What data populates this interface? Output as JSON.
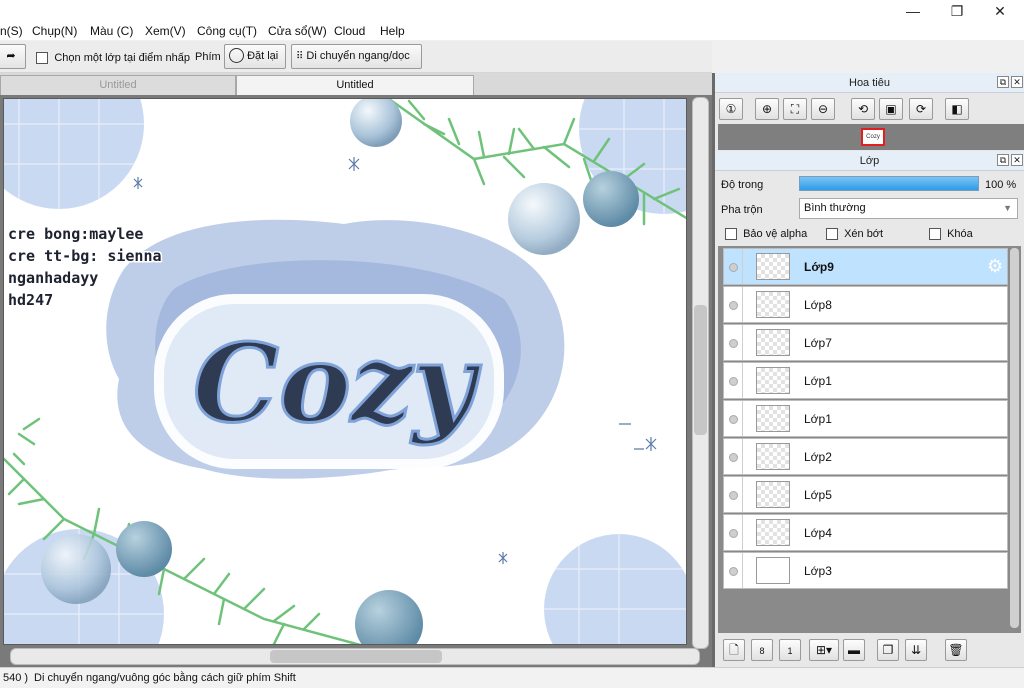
{
  "menu": [
    {
      "id": "menu-select",
      "label": "n(S)"
    },
    {
      "id": "menu-capture",
      "label": "Chụp(N)"
    },
    {
      "id": "menu-color",
      "label": "Màu (C)"
    },
    {
      "id": "menu-view",
      "label": "Xem(V)"
    },
    {
      "id": "menu-tools",
      "label": "Công cụ(T)"
    },
    {
      "id": "menu-window",
      "label": "Cửa sổ(W)"
    },
    {
      "id": "menu-cloud",
      "label": "Cloud"
    },
    {
      "id": "menu-help",
      "label": "Help"
    }
  ],
  "window_controls": {
    "minimize": "—",
    "maximize": "❐",
    "close": "✕"
  },
  "toolbar": {
    "select_layer_label": "Chọn một lớp tại điểm nhấp",
    "key_label": "Phím",
    "reset_label": "Đặt lại",
    "move_label": "Di chuyển ngang/dọc"
  },
  "tabs": [
    {
      "label": "Untitled",
      "active": false
    },
    {
      "label": "Untitled",
      "active": true
    }
  ],
  "canvas_art": {
    "credits": [
      "cre bong:maylee",
      "cre tt-bg: sienna",
      "nganhadayy",
      "hd247"
    ],
    "title_text": "Cozy"
  },
  "navigator": {
    "title": "Hoa tiêu",
    "thumb_text": "Cozy",
    "buttons": [
      "zoom-actual-icon",
      "zoom-in-icon",
      "fit-icon",
      "zoom-out-icon",
      "rotate-left-icon",
      "fit-screen-icon",
      "rotate-right-icon",
      "flip-icon"
    ]
  },
  "layers": {
    "title": "Lớp",
    "opacity_label": "Độ trong",
    "opacity_value": "100 %",
    "opacity": 1.0,
    "blend_label": "Pha trộn",
    "blend_value": "Bình thường",
    "protect_alpha_label": "Bảo vệ alpha",
    "clip_label": "Xén bớt",
    "lock_label": "Khóa",
    "items": [
      {
        "name": "Lớp9",
        "selected": true
      },
      {
        "name": "Lớp8",
        "selected": false
      },
      {
        "name": "Lớp7",
        "selected": false
      },
      {
        "name": "Lớp1",
        "selected": false
      },
      {
        "name": "Lớp1",
        "selected": false
      },
      {
        "name": "Lớp2",
        "selected": false
      },
      {
        "name": "Lớp5",
        "selected": false
      },
      {
        "name": "Lớp4",
        "selected": false
      },
      {
        "name": "Lớp3",
        "selected": false
      }
    ]
  },
  "status": {
    "coords": "540 )",
    "message": "Di chuyển ngang/vuông góc bằng cách giữ phím Shift"
  },
  "colors": {
    "accent": "#4aa8ea",
    "selected_layer": "#bfe3ff",
    "pine": "#6fc27a",
    "ice_blue": "#c9d9f2"
  }
}
